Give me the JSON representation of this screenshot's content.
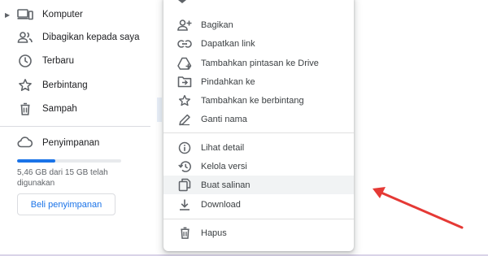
{
  "sidebar": {
    "items": [
      {
        "label": "Komputer",
        "icon": "computer-icon",
        "has_caret": true
      },
      {
        "label": "Dibagikan kepada saya",
        "icon": "shared-people-icon"
      },
      {
        "label": "Terbaru",
        "icon": "clock-icon"
      },
      {
        "label": "Berbintang",
        "icon": "star-icon"
      },
      {
        "label": "Sampah",
        "icon": "trash-icon"
      }
    ],
    "storage": {
      "label": "Penyimpanan",
      "icon": "cloud-icon",
      "used_fraction": 0.364,
      "usage_text": "5,46 GB dari 15 GB telah digunakan",
      "buy_label": "Beli penyimpanan"
    }
  },
  "context_menu": {
    "items": [
      {
        "label": "Bagikan",
        "icon": "person-add-icon"
      },
      {
        "label": "Dapatkan link",
        "icon": "link-icon"
      },
      {
        "label": "Tambahkan pintasan ke Drive",
        "icon": "add-shortcut-icon"
      },
      {
        "label": "Pindahkan ke",
        "icon": "move-folder-icon"
      },
      {
        "label": "Tambahkan ke berbintang",
        "icon": "star-outline-icon"
      },
      {
        "label": "Ganti nama",
        "icon": "pencil-icon"
      },
      {
        "label": "Lihat detail",
        "icon": "info-icon"
      },
      {
        "label": "Kelola versi",
        "icon": "history-icon"
      },
      {
        "label": "Buat salinan",
        "icon": "copy-icon",
        "highlighted": true
      },
      {
        "label": "Download",
        "icon": "download-icon"
      },
      {
        "label": "Hapus",
        "icon": "trash-icon"
      }
    ]
  },
  "colors": {
    "accent": "#1a73e8",
    "highlight": "#f1f3f4",
    "annotation_arrow": "#e53935"
  }
}
